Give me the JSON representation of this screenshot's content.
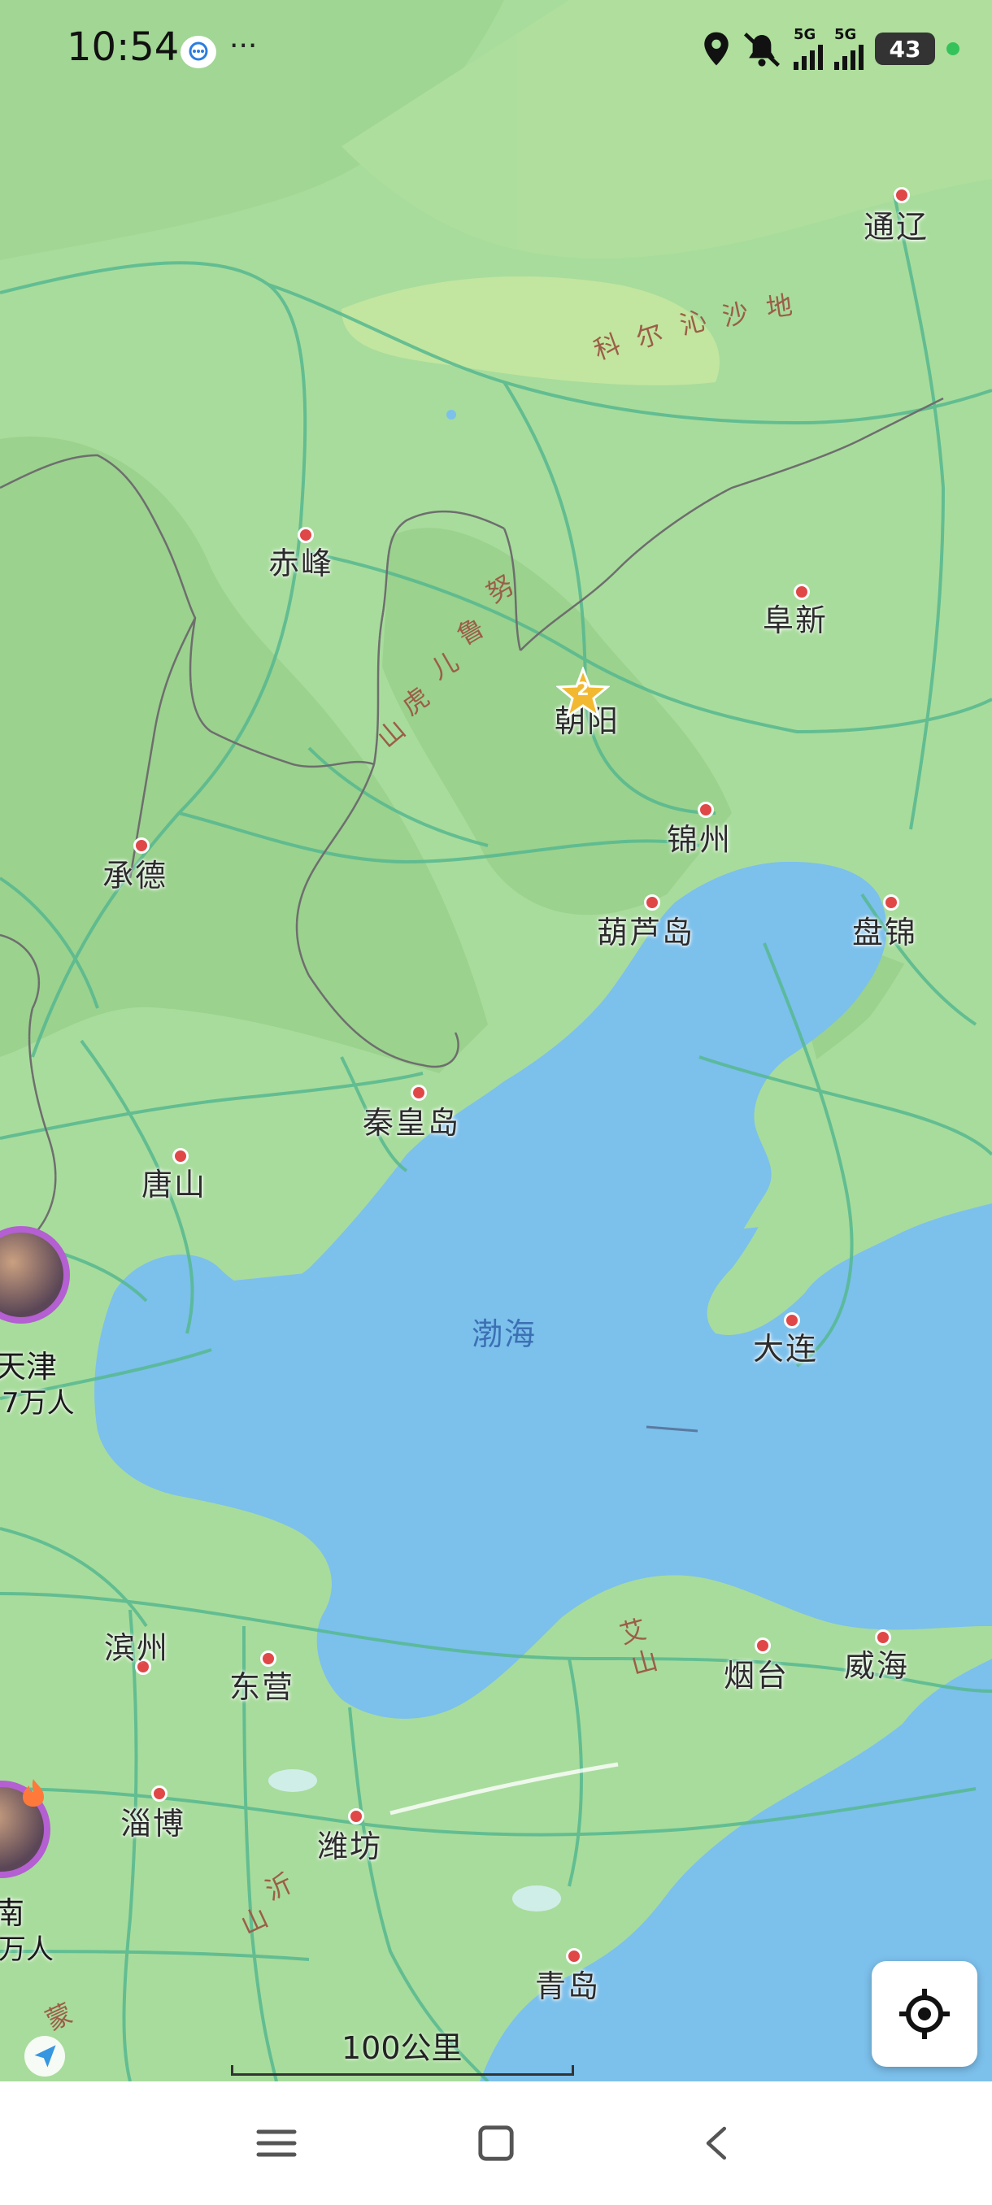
{
  "status_bar": {
    "time": "10:54",
    "more": "···",
    "signal_1": "5G",
    "signal_2": "5G",
    "battery": "43",
    "icons": [
      "chat-bubble-icon",
      "location-icon",
      "mute-icon",
      "signal-icon",
      "battery-icon"
    ]
  },
  "map": {
    "colors": {
      "land": "#a8dc9c",
      "sea": "#7cc0ec",
      "road": "#56b890",
      "border": "#6e6e6e"
    },
    "cities": [
      {
        "id": "tongliao",
        "name": "通辽"
      },
      {
        "id": "chifeng",
        "name": "赤峰"
      },
      {
        "id": "fuxin",
        "name": "阜新"
      },
      {
        "id": "chaoyang",
        "name": "朝阳"
      },
      {
        "id": "jinzhou",
        "name": "锦州"
      },
      {
        "id": "chengde",
        "name": "承德"
      },
      {
        "id": "huludao",
        "name": "葫芦岛"
      },
      {
        "id": "panjin",
        "name": "盘锦"
      },
      {
        "id": "qinhuangdao",
        "name": "秦皇岛"
      },
      {
        "id": "tangshan",
        "name": "唐山"
      },
      {
        "id": "dalian",
        "name": "大连"
      },
      {
        "id": "binzhou",
        "name": "滨州"
      },
      {
        "id": "dongying",
        "name": "东营"
      },
      {
        "id": "yantai",
        "name": "烟台"
      },
      {
        "id": "weihai",
        "name": "威海"
      },
      {
        "id": "zibo",
        "name": "淄博"
      },
      {
        "id": "weifang",
        "name": "潍坊"
      },
      {
        "id": "qingdao",
        "name": "青岛"
      }
    ],
    "sea_name": "渤海",
    "features": {
      "horqin": [
        "科",
        "尔",
        "沁",
        "沙",
        "地"
      ],
      "nuluerhu": [
        "努",
        "鲁",
        "儿",
        "虎",
        "山"
      ],
      "aishan": [
        "艾",
        "山"
      ],
      "yishan": [
        "沂",
        "山"
      ],
      "mengshan": "蒙"
    },
    "cluster_count": "2",
    "tianjin_label": "天津",
    "tianjin_count": "7万人",
    "jinan_label": "南",
    "jinan_count": "万人",
    "scale": "100公里"
  },
  "controls": {
    "locate_icon": "locate-target-icon"
  },
  "nav": {
    "icons": [
      "menu-icon",
      "home-square-icon",
      "back-chevron-icon"
    ]
  }
}
